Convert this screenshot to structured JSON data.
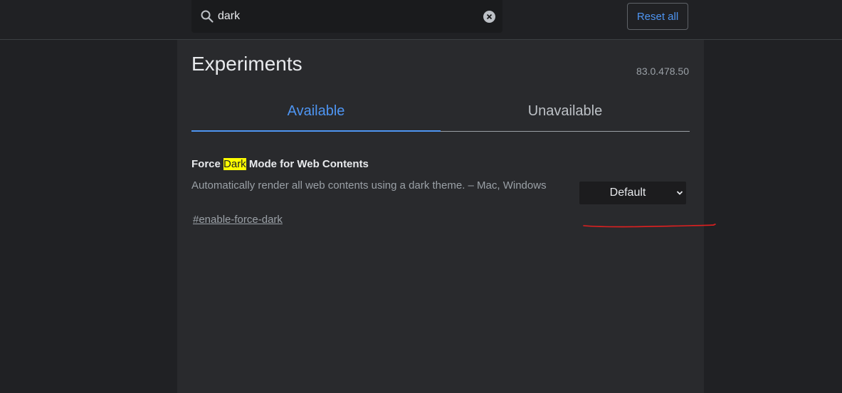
{
  "search": {
    "value": "dark",
    "icon": "search-icon",
    "clear_icon": "close-circle-icon"
  },
  "header": {
    "reset_label": "Reset all"
  },
  "page": {
    "title": "Experiments",
    "version": "83.0.478.50"
  },
  "tabs": [
    {
      "label": "Available",
      "active": true
    },
    {
      "label": "Unavailable",
      "active": false
    }
  ],
  "experiments": [
    {
      "title_before": "Force ",
      "title_highlight": "Dark",
      "title_after": " Mode for Web Contents",
      "description": "Automatically render all web contents using a dark theme. – Mac, Windows",
      "link": "#enable-force-dark",
      "select_value": "Default"
    }
  ],
  "colors": {
    "accent": "#4e95f2",
    "highlight": "#ffff00",
    "annotation": "#e02020",
    "background": "#202124",
    "panel": "#292a2d"
  }
}
